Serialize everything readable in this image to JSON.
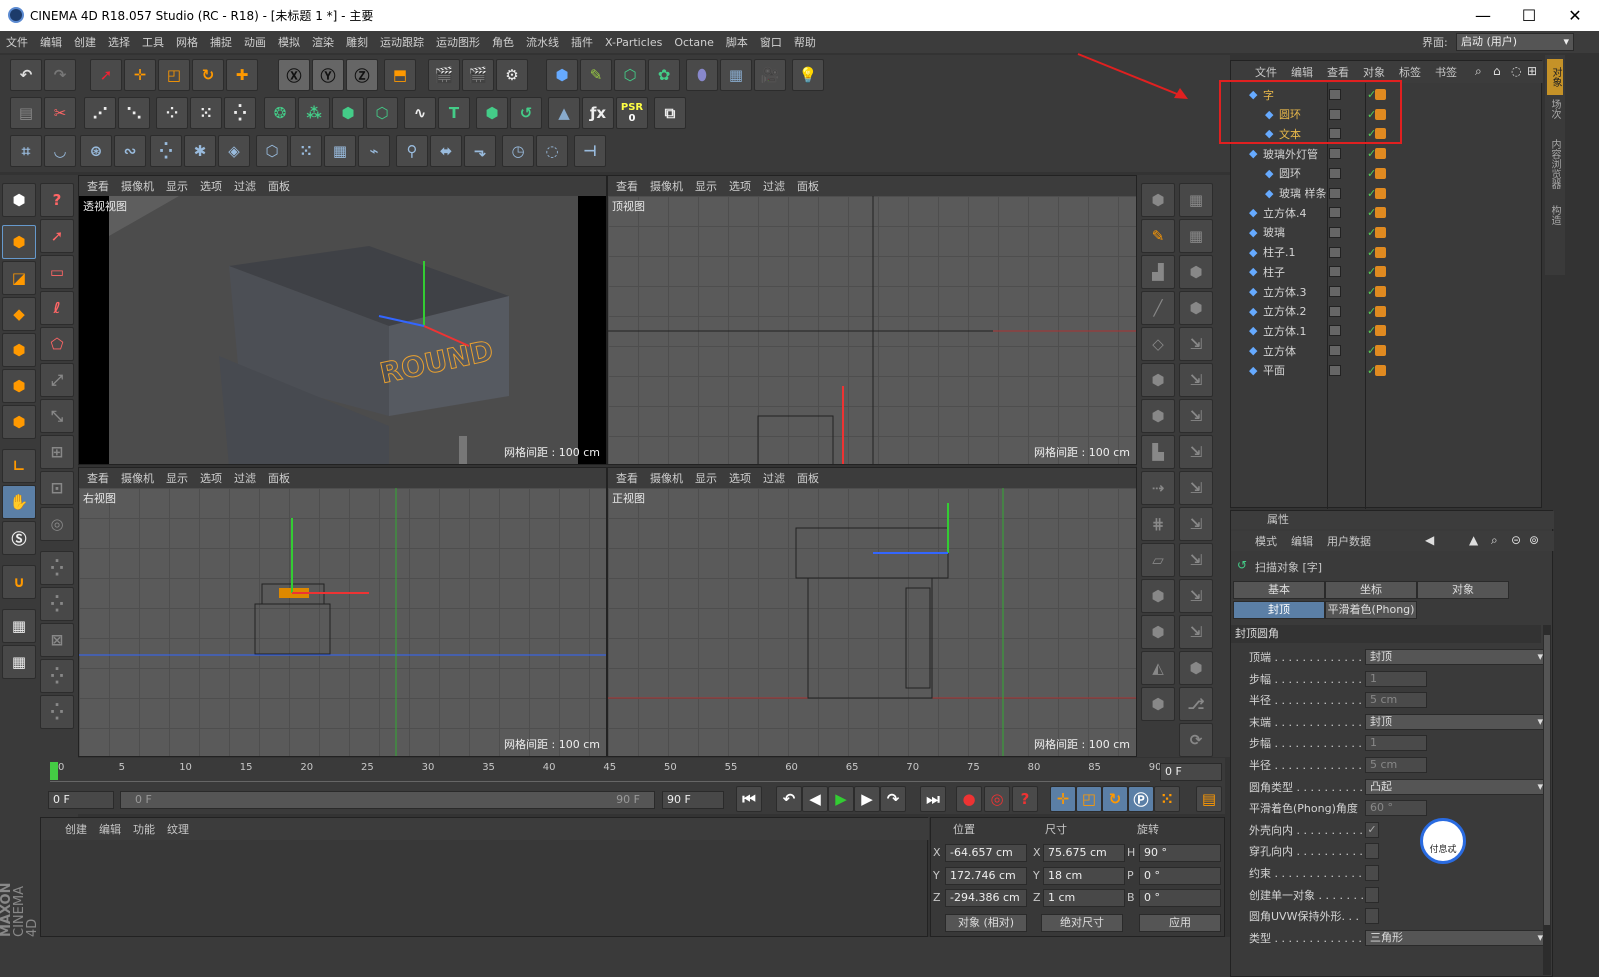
{
  "window": {
    "title": "CINEMA 4D R18.057 Studio (RC - R18) - [未标题 1 *] - 主要",
    "minimize": "—",
    "maximize": "☐",
    "close": "✕"
  },
  "menu": [
    "文件",
    "编辑",
    "创建",
    "选择",
    "工具",
    "网格",
    "捕捉",
    "动画",
    "模拟",
    "渲染",
    "雕刻",
    "运动跟踪",
    "运动图形",
    "角色",
    "流水线",
    "插件",
    "X-Particles",
    "Octane",
    "脚本",
    "窗口",
    "帮助"
  ],
  "interface": {
    "label": "界面:",
    "value": "启动 (用户)"
  },
  "viewport_menu": [
    "查看",
    "摄像机",
    "显示",
    "选项",
    "过滤",
    "面板"
  ],
  "viewports": [
    {
      "name": "透视视图",
      "grid": "网格间距 : 100 cm"
    },
    {
      "name": "顶视图",
      "grid": "网格间距 : 100 cm"
    },
    {
      "name": "右视图",
      "grid": "网格间距 : 100 cm"
    },
    {
      "name": "正视图",
      "grid": "网格间距 : 100 cm"
    }
  ],
  "psr": {
    "label": "PSR",
    "value": "0"
  },
  "object_manager": {
    "menu": [
      "文件",
      "编辑",
      "查看",
      "对象",
      "标签",
      "书签"
    ],
    "objects": [
      {
        "name": "字",
        "indent": 0,
        "color": "#e8b84a"
      },
      {
        "name": "圆环",
        "indent": 1,
        "color": "#e8b84a"
      },
      {
        "name": "文本",
        "indent": 1,
        "color": "#e8b84a"
      },
      {
        "name": "玻璃外灯管",
        "indent": 0,
        "color": "#d4d4d4"
      },
      {
        "name": "圆环",
        "indent": 1,
        "color": "#d4d4d4"
      },
      {
        "name": "玻璃 样条",
        "indent": 1,
        "color": "#d4d4d4"
      },
      {
        "name": "立方体.4",
        "indent": 0,
        "color": "#d4d4d4"
      },
      {
        "name": "玻璃",
        "indent": 0,
        "color": "#d4d4d4"
      },
      {
        "name": "柱子.1",
        "indent": 0,
        "color": "#d4d4d4"
      },
      {
        "name": "柱子",
        "indent": 0,
        "color": "#d4d4d4"
      },
      {
        "name": "立方体.3",
        "indent": 0,
        "color": "#d4d4d4"
      },
      {
        "name": "立方体.2",
        "indent": 0,
        "color": "#d4d4d4"
      },
      {
        "name": "立方体.1",
        "indent": 0,
        "color": "#d4d4d4"
      },
      {
        "name": "立方体",
        "indent": 0,
        "color": "#d4d4d4"
      },
      {
        "name": "平面",
        "indent": 0,
        "color": "#d4d4d4"
      }
    ]
  },
  "side_tabs": [
    "对象",
    "场次",
    "内容浏览器",
    "构造"
  ],
  "attributes": {
    "title": "属性",
    "menu": [
      "模式",
      "编辑",
      "用户数据"
    ],
    "object": "扫描对象 [字]",
    "tabs": [
      "基本",
      "坐标",
      "对象",
      "封顶",
      "平滑着色(Phong)"
    ],
    "section": "封顶圆角",
    "rows": [
      {
        "label": "顶端 . . . . . . . . . . . . .",
        "value": "封顶",
        "type": "drop"
      },
      {
        "label": "步幅 . . . . . . . . . . . . .",
        "value": "1",
        "type": "num"
      },
      {
        "label": "半径 . . . . . . . . . . . . .",
        "value": "5 cm",
        "type": "num"
      },
      {
        "label": "末端 . . . . . . . . . . . . .",
        "value": "封顶",
        "type": "drop"
      },
      {
        "label": "步幅 . . . . . . . . . . . . .",
        "value": "1",
        "type": "num"
      },
      {
        "label": "半径 . . . . . . . . . . . . .",
        "value": "5 cm",
        "type": "num"
      },
      {
        "label": "圆角类型 . . . . . . . . . .",
        "value": "凸起",
        "type": "drop"
      },
      {
        "label": "平滑着色(Phong)角度",
        "value": "60 °",
        "type": "num"
      },
      {
        "label": "外壳向内 . . . . . . . . . .",
        "value": "✓",
        "type": "chk"
      },
      {
        "label": "穿孔向内 . . . . . . . . . .",
        "value": "",
        "type": "chk"
      },
      {
        "label": "约束 . . . . . . . . . . . . .",
        "value": "",
        "type": "chk"
      },
      {
        "label": "创建单一对象 . . . . . . .",
        "value": "",
        "type": "chk"
      },
      {
        "label": "圆角UVW保持外形. . .",
        "value": "",
        "type": "chk"
      },
      {
        "label": "类型 . . . . . . . . . . . . .",
        "value": "三角形",
        "type": "drop"
      }
    ]
  },
  "timeline": {
    "ticks": [
      "0",
      "5",
      "10",
      "15",
      "20",
      "25",
      "30",
      "35",
      "40",
      "45",
      "50",
      "55",
      "60",
      "65",
      "70",
      "75",
      "80",
      "85",
      "90"
    ],
    "current": "0 F"
  },
  "transport": {
    "start": "0 F",
    "range_start": "0 F",
    "range_end": "90 F",
    "end": "90 F"
  },
  "materials": {
    "menu": [
      "创建",
      "编辑",
      "功能",
      "纹理"
    ]
  },
  "coordinates": {
    "headers": [
      "位置",
      "尺寸",
      "旋转"
    ],
    "rows": [
      {
        "axis": "X",
        "pos": "-64.657 cm",
        "size_axis": "X",
        "size": "75.675 cm",
        "rot_axis": "H",
        "rot": "90 °"
      },
      {
        "axis": "Y",
        "pos": "172.746 cm",
        "size_axis": "Y",
        "size": "18 cm",
        "rot_axis": "P",
        "rot": "0 °"
      },
      {
        "axis": "Z",
        "pos": "-294.386 cm",
        "size_axis": "Z",
        "size": "1 cm",
        "rot_axis": "B",
        "rot": "0 °"
      }
    ],
    "mode": "对象 (相对)",
    "size_mode": "绝对尺寸",
    "apply": "应用"
  },
  "brand": {
    "line1": "MAXON",
    "line2": "CINEMA 4D"
  },
  "watermark_text": "付息忒",
  "colors": {
    "highlight": "#e8b84a",
    "red_box": "#e02020",
    "accent_blue": "#4a7ab8"
  }
}
